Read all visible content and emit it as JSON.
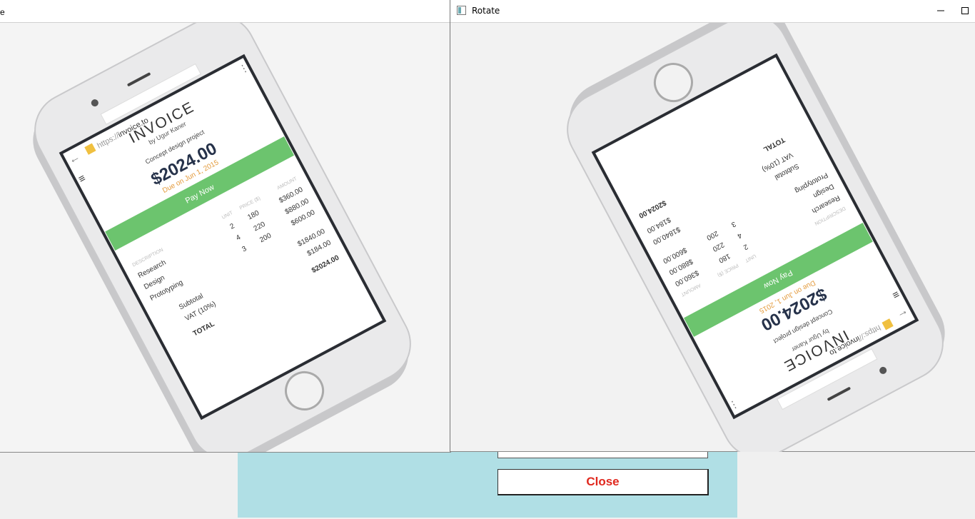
{
  "right_window": {
    "title": "Rotate"
  },
  "dialog": {
    "close_label": "Close"
  },
  "invoice": {
    "url_prefix": "https://",
    "url_domain": "invoice.to",
    "title": "INVOICE",
    "author": "by Ugur Kaner",
    "project": "Concept design project",
    "amount": "$2024.00",
    "due": "Due on Jun 1, 2015",
    "pay_label": "Pay Now",
    "headers": {
      "description": "DESCRIPTION",
      "unit": "UNIT",
      "price": "PRICE ($)",
      "amount": "AMOUNT"
    },
    "rows": [
      {
        "description": "Research",
        "unit": "2",
        "price": "180",
        "amount": "$360.00"
      },
      {
        "description": "Design",
        "unit": "4",
        "price": "220",
        "amount": "$880.00"
      },
      {
        "description": "Prototyping",
        "unit": "3",
        "price": "200",
        "amount": "$600.00"
      }
    ],
    "subtotal_label": "Subtotal",
    "subtotal": "$1840.00",
    "vat_label": "VAT (10%)",
    "vat": "$184.00",
    "total_label": "TOTAL",
    "total": "$2024.00"
  },
  "colors": {
    "accent_green": "#6cc46e",
    "due_orange": "#e39a3b",
    "close_red": "#e0281e",
    "dialog_bg": "#b0dfe5"
  }
}
